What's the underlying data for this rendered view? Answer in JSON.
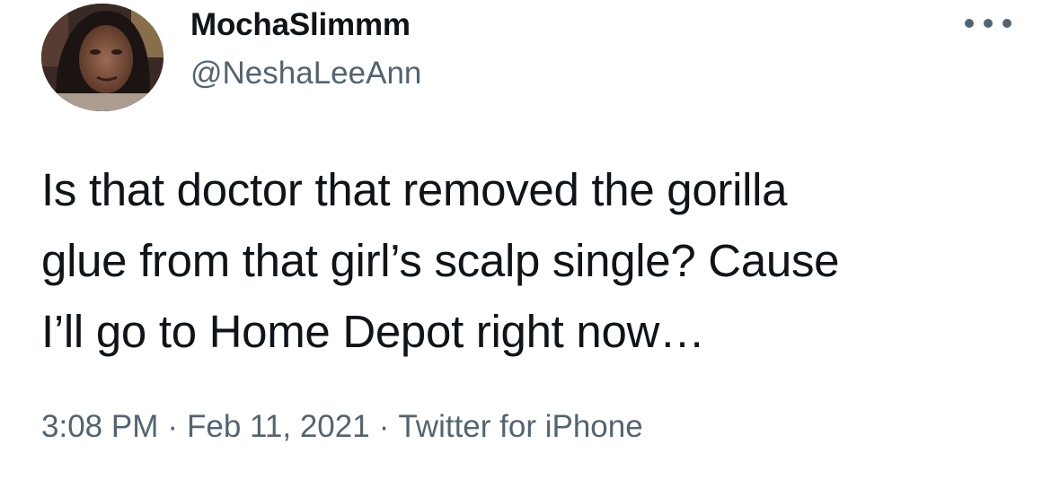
{
  "tweet": {
    "author": {
      "display_name": "MochaSlimmm",
      "handle": "@NeshaLeeAnn",
      "avatar_icon": "profile-photo"
    },
    "more_icon": "ellipsis-icon",
    "text_lines": [
      "Is that doctor that removed the gorilla",
      "glue from that girl’s scalp single? Cause",
      "I’ll go to Home Depot right now…"
    ],
    "time": "3:08 PM",
    "date": "Feb 11, 2021",
    "separator": "·",
    "source": "Twitter for iPhone"
  },
  "colors": {
    "primary_text": "#0f1419",
    "secondary_text": "#536471",
    "background": "#ffffff"
  }
}
